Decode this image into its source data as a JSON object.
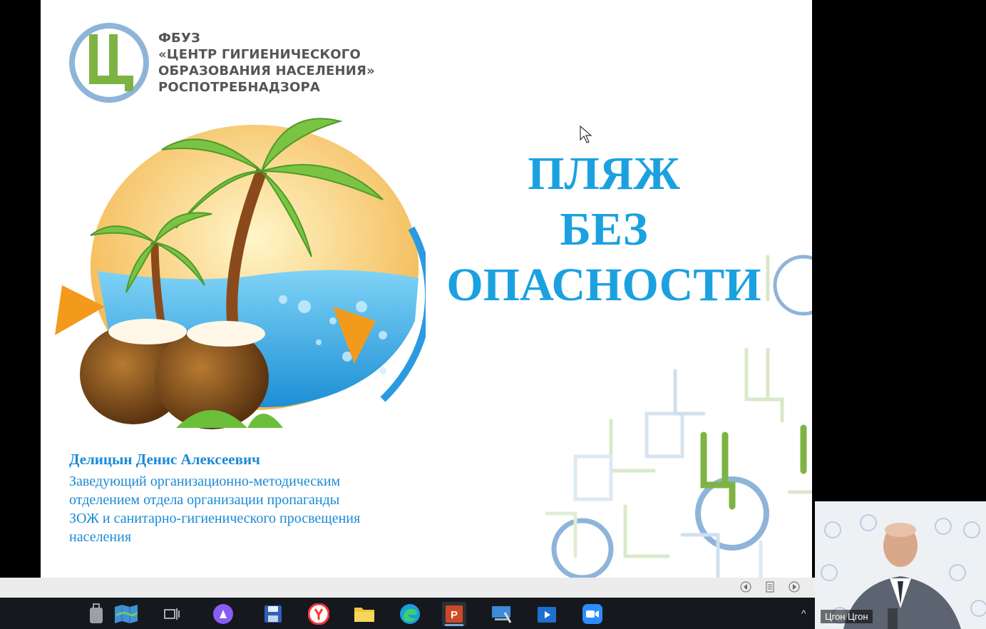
{
  "slide": {
    "org_lines": [
      "ФБУЗ",
      "«ЦЕНТР ГИГИЕНИЧЕСКОГО",
      "ОБРАЗОВАНИЯ НАСЕЛЕНИЯ»",
      "РОСПОТРЕБНАДЗОРА"
    ],
    "title_lines": [
      "ПЛЯЖ",
      "БЕЗ",
      "ОПАСНОСТИ"
    ],
    "author": "Делицын Денис Алексеевич",
    "position_lines": [
      "Заведующий организационно-методическим",
      "отделением отдела организации пропаганды",
      "ЗОЖ и санитарно-гигиенического просвещения",
      "населения"
    ],
    "logo_letter": "Ц"
  },
  "video": {
    "participant_name": "Цгон Цгон"
  },
  "taskbar": {
    "icons": [
      "suitcase-icon",
      "map-icon",
      "task-view-icon",
      "alice-icon",
      "save-icon",
      "yandex-browser-icon",
      "file-explorer-icon",
      "edge-icon",
      "powerpoint-icon",
      "remote-desktop-icon",
      "media-player-icon",
      "zoom-icon"
    ],
    "active": "powerpoint-icon",
    "powerpoint_label": "P"
  },
  "colors": {
    "title_blue": "#1ca1e0",
    "text_blue": "#1a8ad6",
    "logo_green": "#7db343",
    "logo_blue": "#8fb4d9"
  }
}
